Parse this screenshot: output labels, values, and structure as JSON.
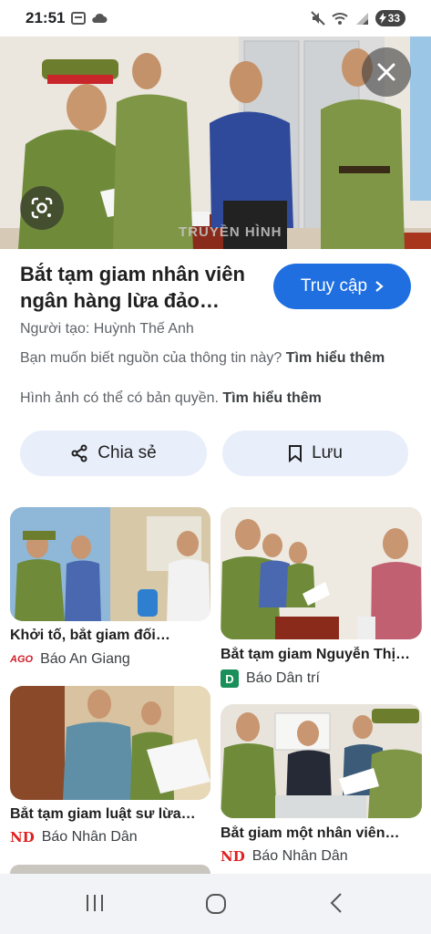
{
  "status": {
    "time": "21:51",
    "battery": "33"
  },
  "detail": {
    "title": "Bắt tạm giam nhân viên ngân hàng lừa đảo…",
    "visit_label": "Truy cập",
    "creator": "Người tạo: Huỳnh Thế Anh",
    "source_question": "Bạn muốn biết nguồn của thông tin này?",
    "learn_more": "Tìm hiểu thêm",
    "copyright": "Hình ảnh có thể có bản quyền.",
    "learn_more_2": "Tìm hiểu thêm",
    "share_label": "Chia sẻ",
    "save_label": "Lưu",
    "watermark": "TRUYỀN HÌNH"
  },
  "related": [
    {
      "title": "Khởi tố, bắt giam đối…",
      "source": "Báo An Giang",
      "logo": "AGO"
    },
    {
      "title": "Bắt tạm giam Nguyễn Thị…",
      "source": "Báo Dân trí",
      "logo": "D"
    },
    {
      "title": "Bắt tạm giam luật sư lừa…",
      "source": "Báo Nhân Dân",
      "logo": "ND"
    },
    {
      "title": "Bắt giam một nhân viên…",
      "source": "Báo Nhân Dân",
      "logo": "ND"
    }
  ],
  "icons": [
    "close-icon",
    "lens-icon",
    "share-icon",
    "bookmark-icon",
    "chevron-right-icon",
    "recent-apps-icon",
    "home-icon",
    "back-icon"
  ]
}
